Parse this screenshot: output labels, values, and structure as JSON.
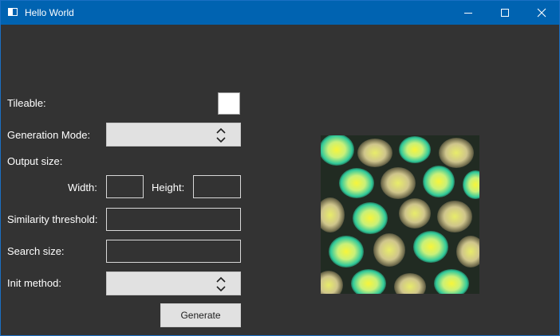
{
  "window": {
    "title": "Hello World",
    "accent_color": "#0063b1",
    "background_color": "#333333",
    "controls": [
      "minimize-icon",
      "maximize-icon",
      "close-icon"
    ]
  },
  "form": {
    "tileable_label": "Tileable:",
    "tileable_checked": false,
    "generation_mode_label": "Generation Mode:",
    "generation_mode_value": "",
    "output_size_label": "Output size:",
    "width_label": "Width:",
    "width_value": "",
    "height_label": "Height:",
    "height_value": "",
    "similarity_label": "Similarity threshold:",
    "similarity_value": "",
    "search_size_label": "Search size:",
    "search_size_value": "",
    "init_method_label": "Init method:",
    "init_method_value": "",
    "generate_label": "Generate"
  },
  "preview": {
    "description_icon": "texture-preview-image",
    "palette": [
      "#f5f23a",
      "#c8f08c",
      "#3fd6a0",
      "#d9c98a",
      "#1b2a1f"
    ]
  }
}
